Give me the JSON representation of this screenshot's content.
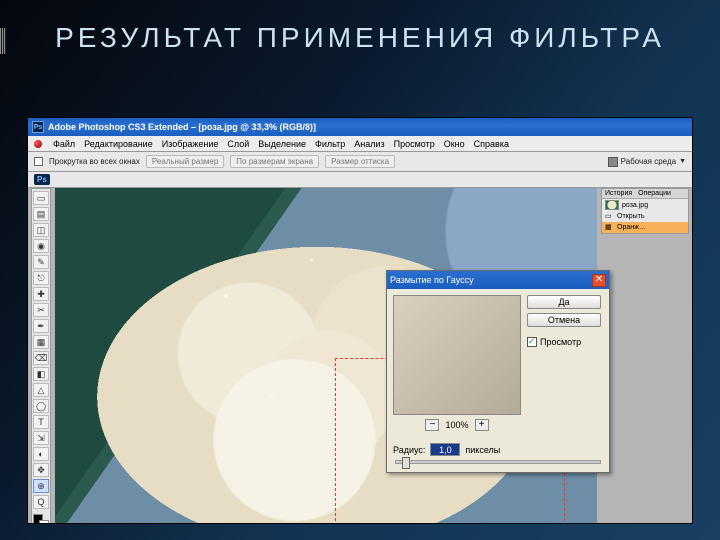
{
  "slide": {
    "title": "РЕЗУЛЬТАТ  ПРИМЕНЕНИЯ ФИЛЬТРА"
  },
  "titlebar": {
    "app": "Adobe Photoshop CS3 Extended – [роза.jpg @ 33,3% (RGB/8)]"
  },
  "menu": [
    "Файл",
    "Редактирование",
    "Изображение",
    "Слой",
    "Выделение",
    "Фильтр",
    "Анализ",
    "Просмотр",
    "Окно",
    "Справка"
  ],
  "optbar": {
    "scroll_all": "Прокрутка во всех окнах",
    "b1": "Реальный размер",
    "b2": "По размерам экрана",
    "b3": "Размер оттиска",
    "workspace": "Рабочая среда",
    "dd": "▼"
  },
  "secbar": {
    "ps": "Ps"
  },
  "tools": [
    "▭",
    "▤",
    "◫",
    "◉",
    "✎",
    "⎋",
    "✚",
    "✂",
    "✒",
    "▦",
    "⌫",
    "◧",
    "△",
    "◯",
    "T",
    "⇲",
    "◐",
    "✥",
    "⊕",
    "Q"
  ],
  "right": {
    "history": {
      "tabs": [
        "История",
        "Операции"
      ],
      "rows": [
        {
          "label": "роза.jpg",
          "icon": "doc"
        },
        {
          "label": "Открыть",
          "icon": "open"
        },
        {
          "label": "Оранж…",
          "icon": "sel",
          "selected": true
        }
      ]
    }
  },
  "dialog": {
    "title": "Размытие по Гауссу",
    "ok": "Да",
    "cancel": "Отмена",
    "preview_chk": "Просмотр",
    "zoom": "100%",
    "radius_label": "Радиус:",
    "radius_value": "1,0",
    "radius_unit": "пикселы"
  }
}
